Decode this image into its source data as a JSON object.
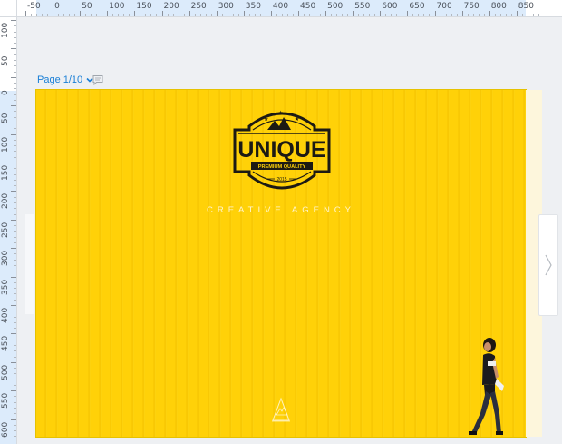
{
  "ruler": {
    "top_labels": [
      "-50",
      "0",
      "50",
      "100",
      "150",
      "200",
      "250",
      "300",
      "350",
      "400",
      "450",
      "500",
      "550",
      "600",
      "650",
      "700",
      "750",
      "800",
      "850"
    ],
    "left_labels": [
      "100",
      "50",
      "0",
      "50",
      "100",
      "150",
      "200",
      "250",
      "300",
      "350",
      "400",
      "450",
      "500",
      "550",
      "600"
    ]
  },
  "page_selector": {
    "label": "Page 1/10"
  },
  "design": {
    "logo": {
      "main_text": "UNIQUE",
      "sub_text": "PREMIUM QUALITY",
      "year": "2015"
    },
    "tagline": "CREATIVE AGENCY"
  },
  "colors": {
    "accent": "#1a7fd6",
    "canvas_yellow": "#ffd108",
    "logo_dark": "#1c1a14"
  },
  "icons": {
    "page_dropdown": "chevron-down-icon",
    "comment": "comment-icon",
    "next_page": "chevron-right-icon"
  }
}
